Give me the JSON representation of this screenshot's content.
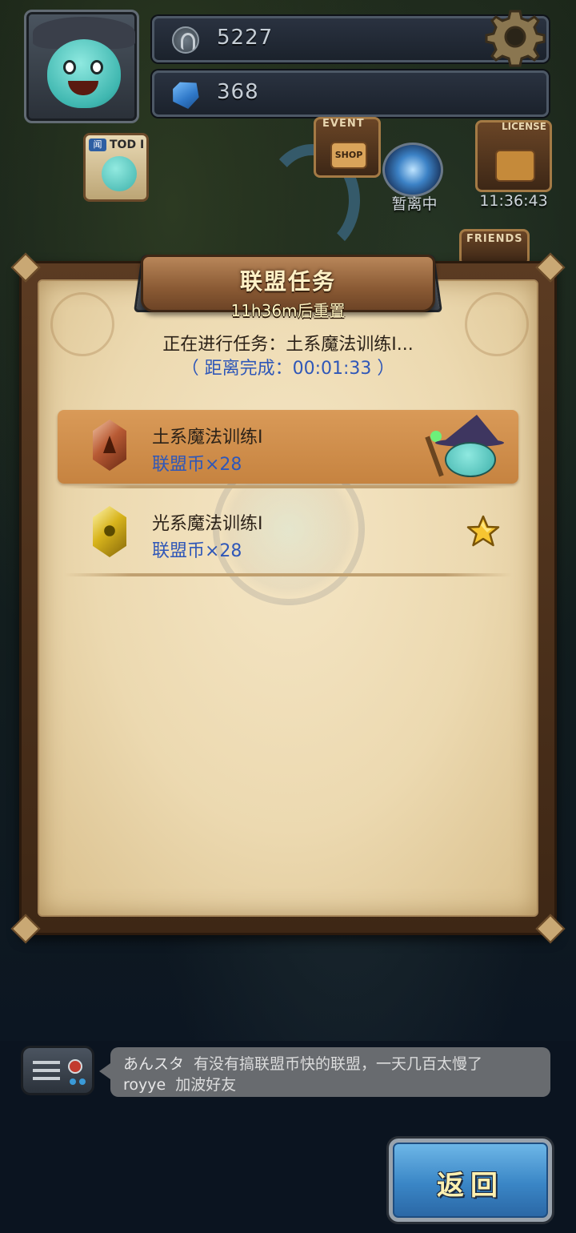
{
  "hud": {
    "coins": "5227",
    "gems": "368",
    "todo_label": "TOD I",
    "todo_tag": "闻",
    "event_label": "EVENT",
    "shop_label": "SHOP",
    "license_label": "LICENSE",
    "friends_label": "FRIENDS",
    "portal_status": "暂离中",
    "license_timer": "11:36:43"
  },
  "panel": {
    "title": "联盟任务",
    "reset_text": "11h36m后重置",
    "current_task": "正在进行任务：土系魔法训练I...",
    "remaining": "（ 距离完成：00:01:33 ）",
    "tasks": [
      {
        "name": "土系魔法训练I",
        "reward": "联盟币×28",
        "crystal": "earth-crystal-icon",
        "status": "in-progress"
      },
      {
        "name": "光系魔法训练I",
        "reward": "联盟币×28",
        "crystal": "light-crystal-icon",
        "status": "available"
      }
    ]
  },
  "chat": {
    "messages": [
      {
        "user": "あんスタ",
        "text": "有没有搞联盟币快的联盟，一天几百太慢了"
      },
      {
        "user": "royye",
        "text": "加波好友"
      }
    ]
  },
  "buttons": {
    "back_label": "返回"
  },
  "colors": {
    "reward_text": "#2f57b8",
    "active_row": "#d99a58",
    "back_button": "#3a86c6"
  }
}
